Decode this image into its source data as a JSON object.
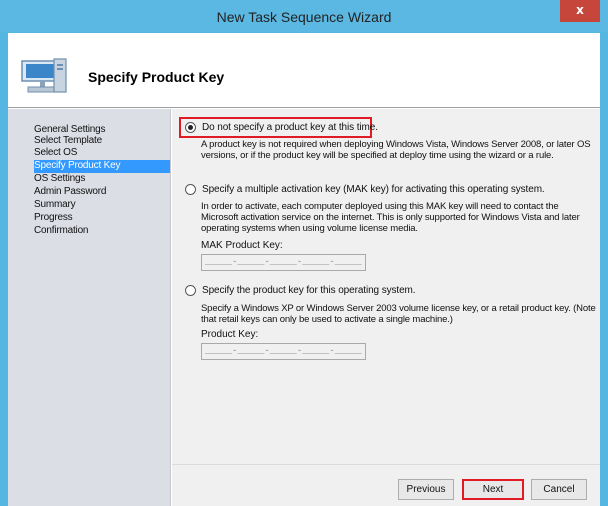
{
  "window": {
    "title": "New Task Sequence Wizard",
    "close_glyph": "x"
  },
  "header": {
    "title": "Specify Product Key",
    "icon": "computer-wizard-icon"
  },
  "sidebar": {
    "items": [
      {
        "label": "General Settings"
      },
      {
        "label": "Select Template"
      },
      {
        "label": "Select OS"
      },
      {
        "label": "Specify Product Key",
        "active": true
      },
      {
        "label": "OS Settings"
      },
      {
        "label": "Admin Password"
      },
      {
        "label": "Summary"
      },
      {
        "label": "Progress"
      },
      {
        "label": "Confirmation"
      }
    ]
  },
  "options": [
    {
      "label": "Do not specify a product key at this time.",
      "selected": true,
      "description": "A product key is not required when deploying Windows Vista, Windows Server 2008, or later OS versions, or if the product key will be specified at deploy time using the wizard or a rule."
    },
    {
      "label": "Specify a multiple activation key (MAK key) for activating this operating system.",
      "selected": false,
      "description": "In order to activate, each computer deployed using this MAK key will need to contact the Microsoft activation service on the internet.  This is only supported for Windows Vista and later operating systems when using volume license media.",
      "field_label": "MAK Product Key:",
      "field_mask": "_____-_____-_____-_____-_____"
    },
    {
      "label": "Specify the product key for this operating system.",
      "selected": false,
      "description": "Specify a Windows XP or Windows Server 2003 volume license key, or a retail product key.  (Note that retail keys can only be used to activate a single machine.)",
      "field_label": "Product Key:",
      "field_mask": "_____-_____-_____-_____-_____"
    }
  ],
  "buttons": {
    "previous": "Previous",
    "next": "Next",
    "cancel": "Cancel"
  },
  "colors": {
    "accent": "#3399ff",
    "highlight_border": "#e01b24",
    "titlebar": "#5bb8e3",
    "close": "#c7463b"
  }
}
